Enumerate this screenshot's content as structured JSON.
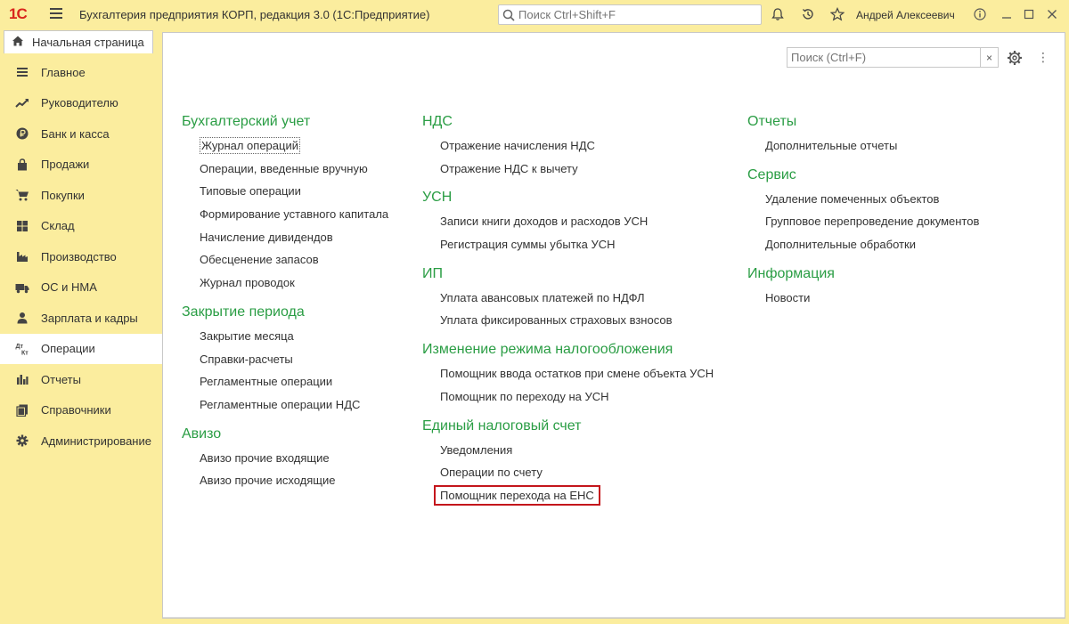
{
  "titlebar": {
    "logo": "1С",
    "app_title": "Бухгалтерия предприятия КОРП, редакция 3.0  (1С:Предприятие)",
    "search_placeholder": "Поиск Ctrl+Shift+F",
    "user_name": "Андрей Алексеевич"
  },
  "home_tab": {
    "label": "Начальная страница"
  },
  "sidebar": {
    "items": [
      {
        "label": "Главное",
        "icon": "list-icon"
      },
      {
        "label": "Руководителю",
        "icon": "trend-icon"
      },
      {
        "label": "Банк и касса",
        "icon": "ruble-coin-icon"
      },
      {
        "label": "Продажи",
        "icon": "bag-icon"
      },
      {
        "label": "Покупки",
        "icon": "cart-icon"
      },
      {
        "label": "Склад",
        "icon": "warehouse-icon"
      },
      {
        "label": "Производство",
        "icon": "factory-icon"
      },
      {
        "label": "ОС и НМА",
        "icon": "truck-icon"
      },
      {
        "label": "Зарплата и кадры",
        "icon": "person-icon"
      },
      {
        "label": "Операции",
        "icon": "dt-kt-icon",
        "active": true
      },
      {
        "label": "Отчеты",
        "icon": "bar-chart-icon"
      },
      {
        "label": "Справочники",
        "icon": "books-icon"
      },
      {
        "label": "Администрирование",
        "icon": "gear-icon"
      }
    ],
    "dt_label": "Дт",
    "kt_label": "Кт"
  },
  "panel": {
    "search_placeholder": "Поиск (Ctrl+F)",
    "clear_label": "×"
  },
  "sections": {
    "col1": [
      {
        "title": "Бухгалтерский учет",
        "links": [
          "Журнал операций",
          "Операции, введенные вручную",
          "Типовые операции",
          "Формирование уставного капитала",
          "Начисление дивидендов",
          "Обесценение запасов",
          "Журнал проводок"
        ]
      },
      {
        "title": "Закрытие периода",
        "links": [
          "Закрытие месяца",
          "Справки-расчеты",
          "Регламентные операции",
          "Регламентные операции НДС"
        ]
      },
      {
        "title": "Авизо",
        "links": [
          "Авизо прочие входящие",
          "Авизо прочие исходящие"
        ]
      }
    ],
    "col2": [
      {
        "title": "НДС",
        "links": [
          "Отражение начисления НДС",
          "Отражение НДС к вычету"
        ]
      },
      {
        "title": "УСН",
        "links": [
          "Записи книги доходов и расходов УСН",
          "Регистрация суммы убытка УСН"
        ]
      },
      {
        "title": "ИП",
        "links": [
          "Уплата авансовых платежей по НДФЛ",
          "Уплата фиксированных страховых взносов"
        ]
      },
      {
        "title": "Изменение режима налогообложения",
        "links": [
          "Помощник ввода остатков при смене объекта УСН",
          "Помощник по переходу на УСН"
        ]
      },
      {
        "title": "Единый налоговый счет",
        "links": [
          "Уведомления",
          "Операции по счету",
          "Помощник перехода на ЕНС"
        ]
      }
    ],
    "col3": [
      {
        "title": "Отчеты",
        "links": [
          "Дополнительные отчеты"
        ]
      },
      {
        "title": "Сервис",
        "links": [
          "Удаление помеченных объектов",
          "Групповое перепроведение документов",
          "Дополнительные обработки"
        ]
      },
      {
        "title": "Информация",
        "links": [
          "Новости"
        ]
      }
    ]
  },
  "colors": {
    "section_title": "#2a9d44",
    "sidebar_bg": "#fbed9e",
    "highlight_border": "#c4161c"
  }
}
